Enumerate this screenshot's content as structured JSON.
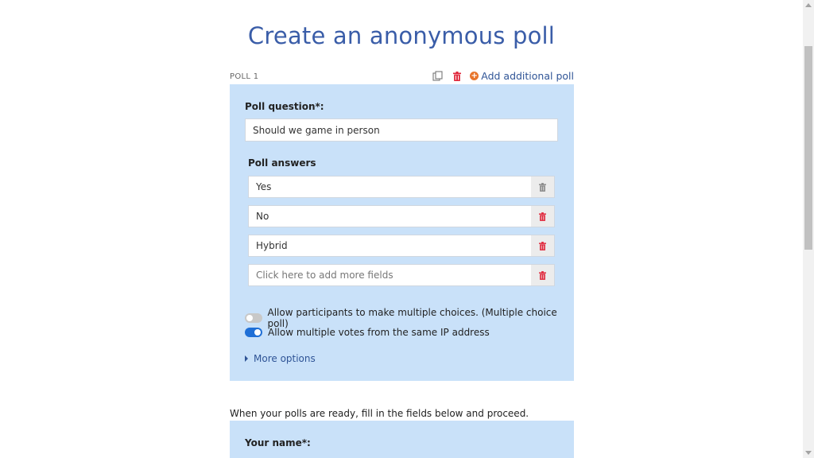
{
  "page": {
    "title": "Create an anonymous poll"
  },
  "poll": {
    "label": "POLL 1",
    "add_poll_label": "Add additional poll",
    "question_label": "Poll question*:",
    "question_value": "Should we game in person",
    "answers_label": "Poll answers",
    "answers": [
      {
        "value": "Yes",
        "placeholder": false,
        "delete_enabled": false
      },
      {
        "value": "No",
        "placeholder": false,
        "delete_enabled": true
      },
      {
        "value": "Hybrid",
        "placeholder": false,
        "delete_enabled": true
      },
      {
        "value": "",
        "placeholder_text": "Click here to add more fields",
        "delete_enabled": true
      }
    ],
    "options": [
      {
        "label": "Allow participants to make multiple choices. (Multiple choice poll)",
        "enabled": false
      },
      {
        "label": "Allow multiple votes from the same IP address",
        "enabled": true
      }
    ],
    "more_options_label": "More options"
  },
  "form": {
    "instructions": "When your polls are ready, fill in the fields below and proceed.",
    "name_label": "Your name*:"
  },
  "colors": {
    "panel_bg": "#c9e1f9",
    "title": "#3a5da8",
    "trash_red": "#e0263a",
    "trash_gray": "#888888",
    "add_orange": "#e8752b",
    "toggle_on": "#1f6fd6"
  }
}
